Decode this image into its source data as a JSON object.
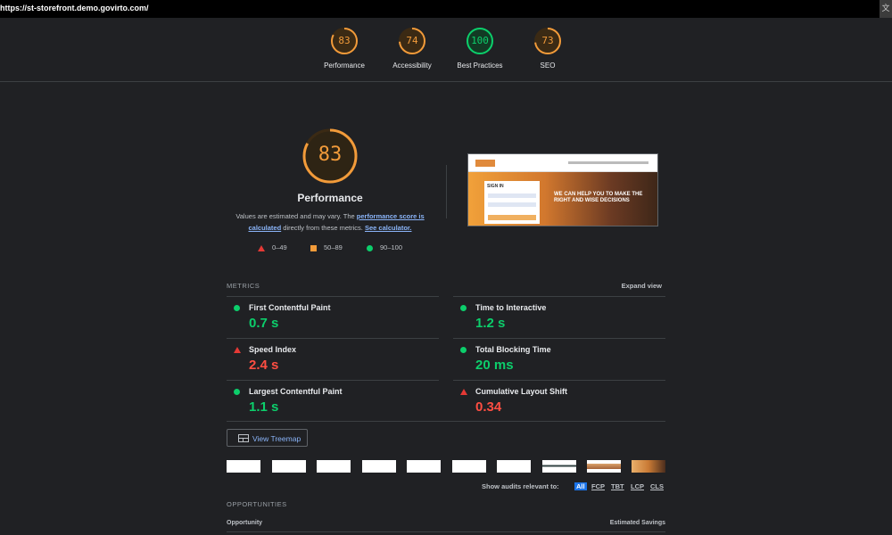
{
  "browser": {
    "url": "https://st-storefront.demo.govirto.com/",
    "translate_icon": "translate-icon"
  },
  "summary": [
    {
      "score": "83",
      "label": "Performance",
      "value": 0.83,
      "color": "#f29b3a"
    },
    {
      "score": "74",
      "label": "Accessibility",
      "value": 0.74,
      "color": "#f29b3a"
    },
    {
      "score": "100",
      "label": "Best Practices",
      "value": 1.0,
      "color": "#0cce6b"
    },
    {
      "score": "73",
      "label": "SEO",
      "value": 0.73,
      "color": "#f29b3a"
    }
  ],
  "performance": {
    "score": "83",
    "value": 0.83,
    "title": "Performance",
    "desc_prefix": "Values are estimated and may vary. The ",
    "desc_link1": "performance score is calculated",
    "desc_middle": " directly from these metrics. ",
    "desc_link2": "See calculator."
  },
  "legend": {
    "poor": "0–49",
    "average": "50–89",
    "good": "90–100"
  },
  "thumbnail": {
    "card_title": "SIGN IN",
    "hero_text": "WE CAN HELP YOU TO MAKE THE RIGHT AND WISE DECISIONS"
  },
  "metrics": {
    "heading": "METRICS",
    "expand": "Expand view",
    "items": [
      {
        "name": "First Contentful Paint",
        "value": "0.7 s",
        "status": "good"
      },
      {
        "name": "Time to Interactive",
        "value": "1.2 s",
        "status": "good"
      },
      {
        "name": "Speed Index",
        "value": "2.4 s",
        "status": "poor"
      },
      {
        "name": "Total Blocking Time",
        "value": "20 ms",
        "status": "good"
      },
      {
        "name": "Largest Contentful Paint",
        "value": "1.1 s",
        "status": "good"
      },
      {
        "name": "Cumulative Layout Shift",
        "value": "0.34",
        "status": "poor"
      }
    ]
  },
  "treemap": {
    "label": "View Treemap"
  },
  "audits_filter": {
    "label": "Show audits relevant to:",
    "chips": [
      "All",
      "FCP",
      "TBT",
      "LCP",
      "CLS"
    ]
  },
  "opportunities": {
    "heading": "OPPORTUNITIES",
    "col_left": "Opportunity",
    "col_right": "Estimated Savings"
  },
  "colors": {
    "good": "#0cce6b",
    "average": "#f29b3a",
    "poor": "#ff4e42",
    "link": "#8ab4f8"
  }
}
